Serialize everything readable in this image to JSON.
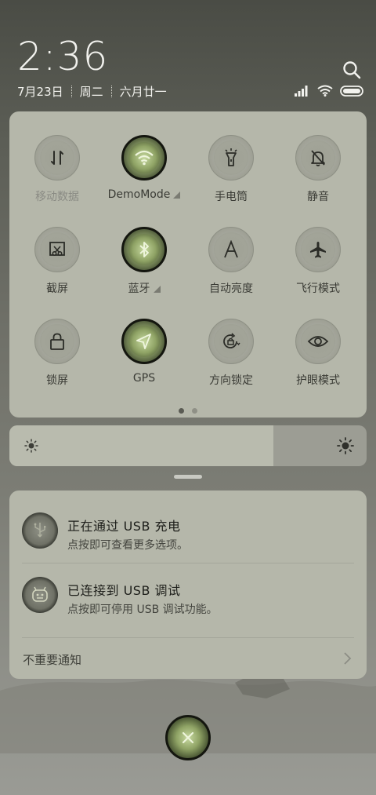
{
  "status": {
    "time": "2:36",
    "date": "7月23日",
    "weekday": "周二",
    "lunar": "六月廿一"
  },
  "quick_settings": {
    "tiles": [
      {
        "label": "移动数据",
        "icon": "mobile-data-icon",
        "on": false,
        "dim": true
      },
      {
        "label": "DemoMode",
        "icon": "wifi-icon",
        "on": true,
        "expand": true
      },
      {
        "label": "手电筒",
        "icon": "flashlight-icon",
        "on": false
      },
      {
        "label": "静音",
        "icon": "bell-off-icon",
        "on": false
      },
      {
        "label": "截屏",
        "icon": "screenshot-icon",
        "on": false
      },
      {
        "label": "蓝牙",
        "icon": "bluetooth-icon",
        "on": true,
        "expand": true
      },
      {
        "label": "自动亮度",
        "icon": "auto-brightness-icon",
        "on": false
      },
      {
        "label": "飞行模式",
        "icon": "airplane-icon",
        "on": false
      },
      {
        "label": "锁屏",
        "icon": "lock-icon",
        "on": false
      },
      {
        "label": "GPS",
        "icon": "location-icon",
        "on": true
      },
      {
        "label": "方向锁定",
        "icon": "rotation-lock-icon",
        "on": false
      },
      {
        "label": "护眼模式",
        "icon": "eye-icon",
        "on": false
      }
    ],
    "page_count": 2,
    "active_page": 1
  },
  "brightness": {
    "level": 0.74
  },
  "notifications": [
    {
      "title": "正在通过  USB  充电",
      "text": "点按即可查看更多选项。",
      "icon": "usb-charging-icon"
    },
    {
      "title": "已连接到  USB  调试",
      "text": "点按即可停用 USB 调试功能。",
      "icon": "android-debug-icon"
    }
  ],
  "unimportant_label": "不重要通知",
  "colors": {
    "panel": "#b5b7aa",
    "accent_on": "#c7d9a0",
    "icon_dark": "#2b2c27"
  }
}
